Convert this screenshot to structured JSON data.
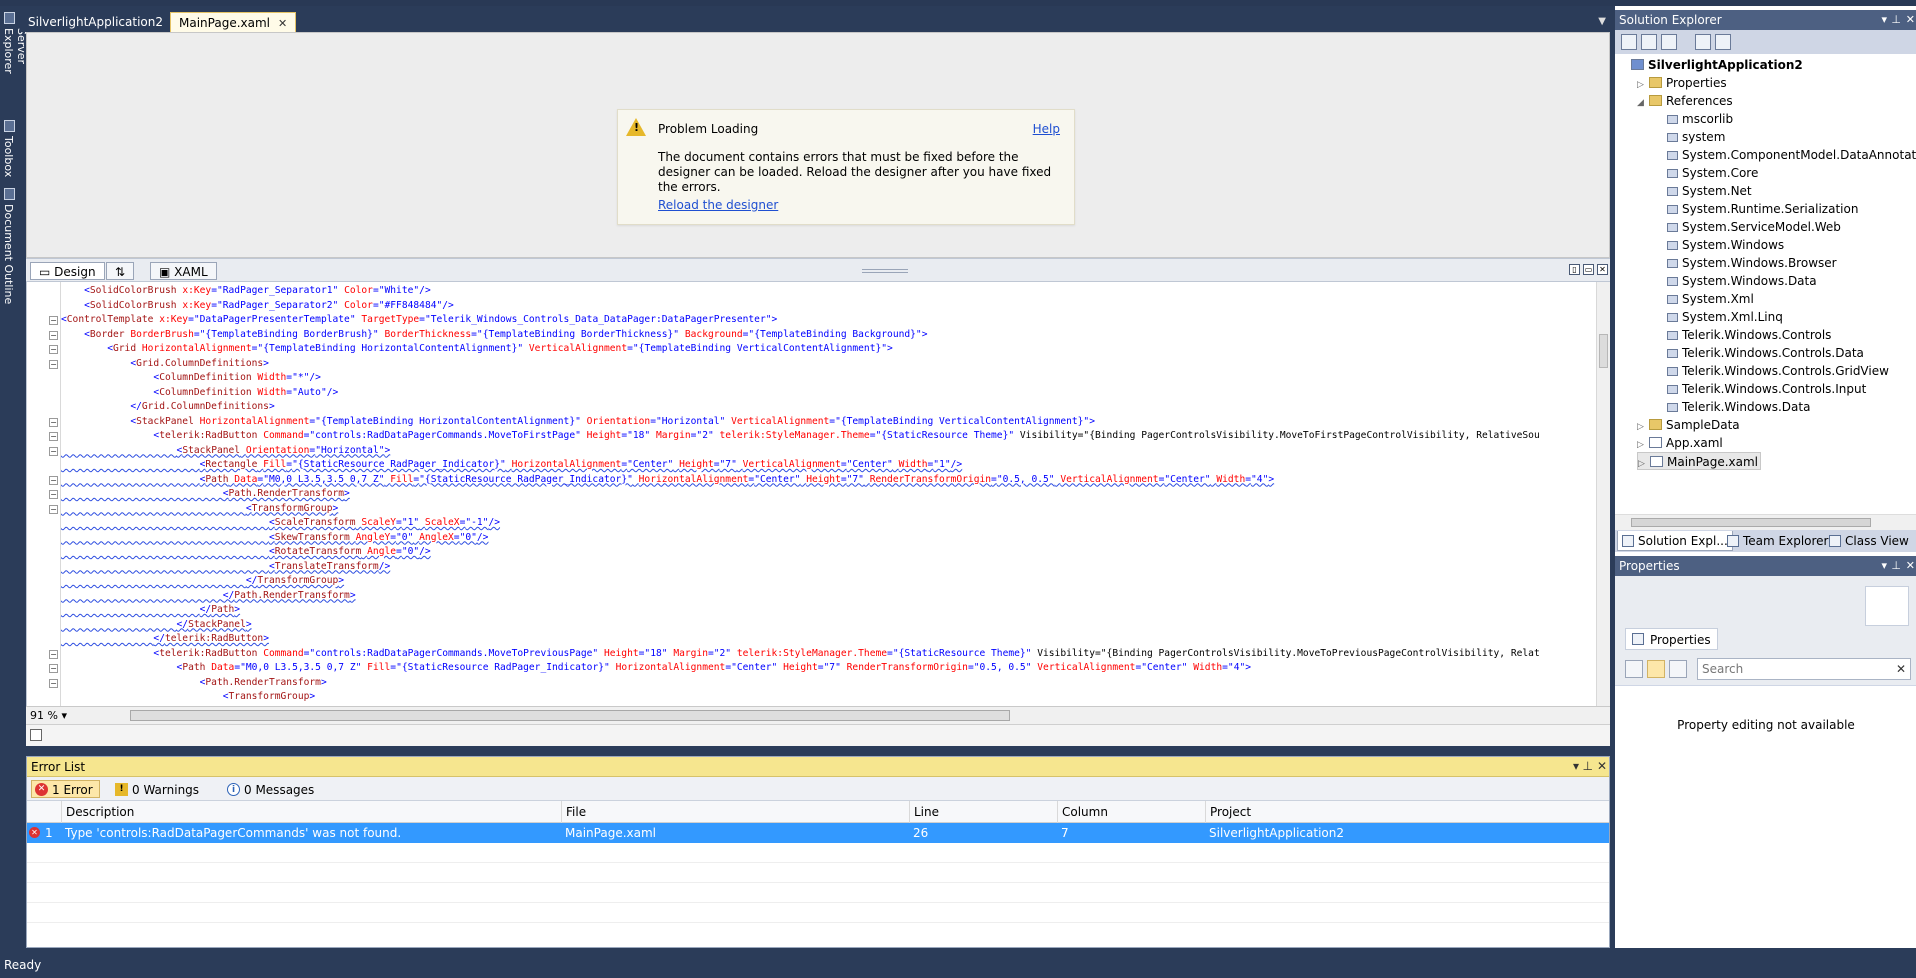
{
  "document_tabs": [
    {
      "label": "SilverlightApplication2",
      "active": false
    },
    {
      "label": "MainPage.xaml",
      "active": true,
      "close": "✕"
    }
  ],
  "left_toolwindows": [
    "Server Explorer",
    "Toolbox",
    "Document Outline"
  ],
  "designer": {
    "problem_title": "Problem Loading",
    "help_link": "Help",
    "message": "The document contains errors that must be fixed before the designer can be loaded. Reload the designer after you have fixed the errors.",
    "reload_link": "Reload the designer"
  },
  "view_tabs": {
    "design": "Design",
    "swap": "⇅",
    "xaml": "XAML"
  },
  "editor": {
    "zoom": "91 %",
    "lines": [
      "    <SolidColorBrush x:Key=\"RadPager_Separator1\" Color=\"White\"/>",
      "    <SolidColorBrush x:Key=\"RadPager_Separator2\" Color=\"#FF848484\"/>",
      "<ControlTemplate x:Key=\"DataPagerPresenterTemplate\" TargetType=\"Telerik_Windows_Controls_Data_DataPager:DataPagerPresenter\">",
      "    <Border BorderBrush=\"{TemplateBinding BorderBrush}\" BorderThickness=\"{TemplateBinding BorderThickness}\" Background=\"{TemplateBinding Background}\">",
      "        <Grid HorizontalAlignment=\"{TemplateBinding HorizontalContentAlignment}\" VerticalAlignment=\"{TemplateBinding VerticalContentAlignment}\">",
      "            <Grid.ColumnDefinitions>",
      "                <ColumnDefinition Width=\"*\"/>",
      "                <ColumnDefinition Width=\"Auto\"/>",
      "            </Grid.ColumnDefinitions>",
      "            <StackPanel HorizontalAlignment=\"{TemplateBinding HorizontalContentAlignment}\" Orientation=\"Horizontal\" VerticalAlignment=\"{TemplateBinding VerticalContentAlignment}\">",
      "                <telerik:RadButton Command=\"controls:RadDataPagerCommands.MoveToFirstPage\" Height=\"18\" Margin=\"2\" telerik:StyleManager.Theme=\"{StaticResource Theme}\" Visibility=\"{Binding PagerControlsVisibility.MoveToFirstPageControlVisibility, RelativeSou",
      "                    <StackPanel Orientation=\"Horizontal\">",
      "                        <Rectangle Fill=\"{StaticResource RadPager_Indicator}\" HorizontalAlignment=\"Center\" Height=\"7\" VerticalAlignment=\"Center\" Width=\"1\"/>",
      "                        <Path Data=\"M0,0 L3.5,3.5 0,7 Z\" Fill=\"{StaticResource RadPager_Indicator}\" HorizontalAlignment=\"Center\" Height=\"7\" RenderTransformOrigin=\"0.5, 0.5\" VerticalAlignment=\"Center\" Width=\"4\">",
      "                            <Path.RenderTransform>",
      "                                <TransformGroup>",
      "                                    <ScaleTransform ScaleY=\"1\" ScaleX=\"-1\"/>",
      "                                    <SkewTransform AngleY=\"0\" AngleX=\"0\"/>",
      "                                    <RotateTransform Angle=\"0\"/>",
      "                                    <TranslateTransform/>",
      "                                </TransformGroup>",
      "                            </Path.RenderTransform>",
      "                        </Path>",
      "                    </StackPanel>",
      "                </telerik:RadButton>",
      "                <telerik:RadButton Command=\"controls:RadDataPagerCommands.MoveToPreviousPage\" Height=\"18\" Margin=\"2\" telerik:StyleManager.Theme=\"{StaticResource Theme}\" Visibility=\"{Binding PagerControlsVisibility.MoveToPreviousPageControlVisibility, Relat",
      "                    <Path Data=\"M0,0 L3.5,3.5 0,7 Z\" Fill=\"{StaticResource RadPager_Indicator}\" HorizontalAlignment=\"Center\" Height=\"7\" RenderTransformOrigin=\"0.5, 0.5\" VerticalAlignment=\"Center\" Width=\"4\">",
      "                        <Path.RenderTransform>",
      "                            <TransformGroup>"
    ]
  },
  "error_list": {
    "title": "Error List",
    "filters": {
      "errors": "1 Error",
      "warnings": "0 Warnings",
      "messages": "0 Messages"
    },
    "columns": [
      "Description",
      "File",
      "Line",
      "Column",
      "Project"
    ],
    "rows": [
      {
        "index": "1",
        "description": "Type 'controls:RadDataPagerCommands' was not found.",
        "file": "MainPage.xaml",
        "line": "26",
        "column": "7",
        "project": "SilverlightApplication2"
      }
    ]
  },
  "solution_explorer": {
    "title": "Solution Explorer",
    "tree": [
      {
        "label": "SilverlightApplication2",
        "depth": 0,
        "expander": "",
        "icon": "proj",
        "bold": true
      },
      {
        "label": "Properties",
        "depth": 1,
        "expander": "▷",
        "icon": "folder"
      },
      {
        "label": "References",
        "depth": 1,
        "expander": "◢",
        "icon": "folder"
      },
      {
        "label": "mscorlib",
        "depth": 2,
        "expander": "",
        "icon": "ref"
      },
      {
        "label": "system",
        "depth": 2,
        "expander": "",
        "icon": "ref"
      },
      {
        "label": "System.ComponentModel.DataAnnotations",
        "depth": 2,
        "expander": "",
        "icon": "ref"
      },
      {
        "label": "System.Core",
        "depth": 2,
        "expander": "",
        "icon": "ref"
      },
      {
        "label": "System.Net",
        "depth": 2,
        "expander": "",
        "icon": "ref"
      },
      {
        "label": "System.Runtime.Serialization",
        "depth": 2,
        "expander": "",
        "icon": "ref"
      },
      {
        "label": "System.ServiceModel.Web",
        "depth": 2,
        "expander": "",
        "icon": "ref"
      },
      {
        "label": "System.Windows",
        "depth": 2,
        "expander": "",
        "icon": "ref"
      },
      {
        "label": "System.Windows.Browser",
        "depth": 2,
        "expander": "",
        "icon": "ref"
      },
      {
        "label": "System.Windows.Data",
        "depth": 2,
        "expander": "",
        "icon": "ref"
      },
      {
        "label": "System.Xml",
        "depth": 2,
        "expander": "",
        "icon": "ref"
      },
      {
        "label": "System.Xml.Linq",
        "depth": 2,
        "expander": "",
        "icon": "ref"
      },
      {
        "label": "Telerik.Windows.Controls",
        "depth": 2,
        "expander": "",
        "icon": "ref"
      },
      {
        "label": "Telerik.Windows.Controls.Data",
        "depth": 2,
        "expander": "",
        "icon": "ref"
      },
      {
        "label": "Telerik.Windows.Controls.GridView",
        "depth": 2,
        "expander": "",
        "icon": "ref"
      },
      {
        "label": "Telerik.Windows.Controls.Input",
        "depth": 2,
        "expander": "",
        "icon": "ref"
      },
      {
        "label": "Telerik.Windows.Data",
        "depth": 2,
        "expander": "",
        "icon": "ref"
      },
      {
        "label": "SampleData",
        "depth": 1,
        "expander": "▷",
        "icon": "folder"
      },
      {
        "label": "App.xaml",
        "depth": 1,
        "expander": "▷",
        "icon": "file"
      },
      {
        "label": "MainPage.xaml",
        "depth": 1,
        "expander": "▷",
        "icon": "file",
        "selected": true
      }
    ],
    "tabs": [
      "Solution Expl...",
      "Team Explorer",
      "Class View"
    ]
  },
  "properties": {
    "title": "Properties",
    "tab": "Properties",
    "search_placeholder": "Search",
    "clear": "✕",
    "message": "Property editing not available"
  },
  "status": {
    "text": "Ready"
  },
  "colors": {
    "accent": "#3399ff",
    "chrome": "#2b3c59",
    "error_title": "#f6e68f",
    "panel_title": "#4d6082"
  }
}
